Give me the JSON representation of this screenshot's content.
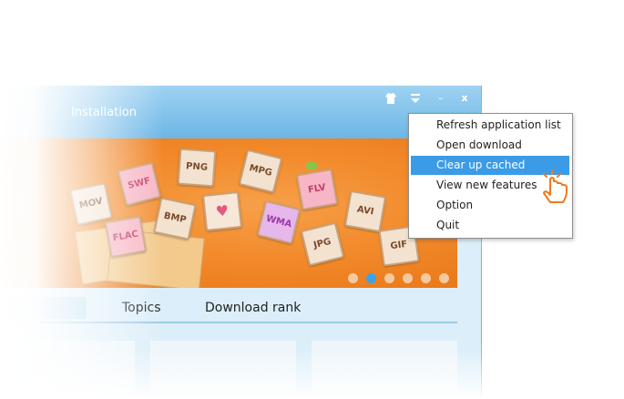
{
  "window": {
    "title": "Installation",
    "buttons": {
      "skin_icon": "shirt-icon",
      "menu_icon": "dropdown-arrow-icon",
      "minimize_icon": "minimize-icon",
      "close_icon": "close-icon",
      "minimize_glyph": "–",
      "close_glyph": "x"
    }
  },
  "banner": {
    "tiles": [
      "MOV",
      "SWF",
      "PNG",
      "MPG",
      "FLV",
      "AVI",
      "FLAC",
      "BMP",
      "♥",
      "WMA",
      "JPG",
      "GIF"
    ],
    "pagination": {
      "count": 6,
      "active_index": 1
    }
  },
  "tabs": [
    {
      "label": "Topics"
    },
    {
      "label": "Download rank"
    }
  ],
  "menu": {
    "items": [
      {
        "label": "Refresh application list"
      },
      {
        "label": "Open download directory"
      },
      {
        "label": "Clear up cached packages"
      },
      {
        "label": "View new features"
      },
      {
        "label": "Option"
      },
      {
        "label": "Quit"
      }
    ],
    "selected_index": 2
  },
  "colors": {
    "accent": "#3b9be6",
    "banner": "#f28a2b",
    "cursor": "#f07a1e"
  },
  "cursor_icon": "hand-pointer-icon"
}
